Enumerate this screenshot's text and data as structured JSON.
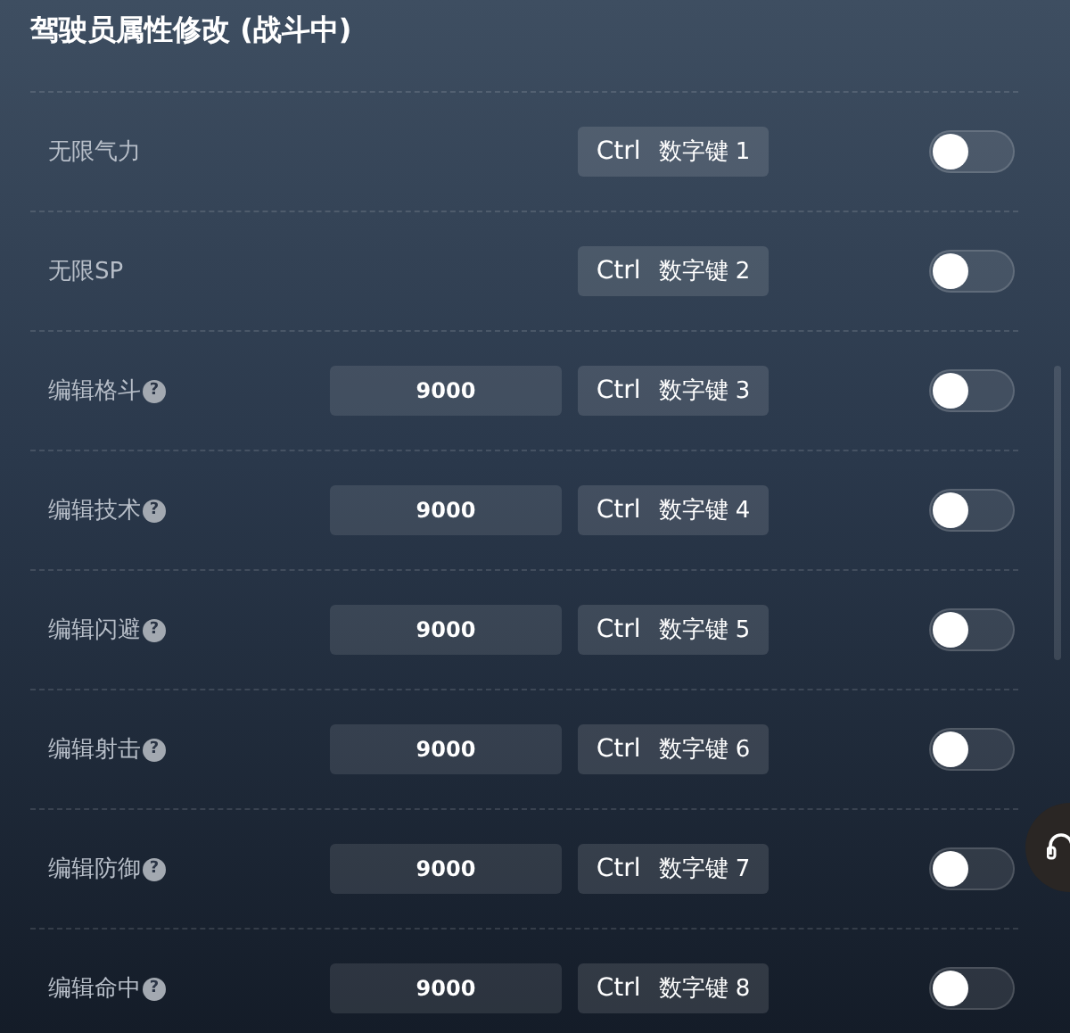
{
  "title": "驾驶员属性修改 (战斗中)",
  "rows": [
    {
      "kind": "toggle",
      "label": "无限气力",
      "hotkey_mod": "Ctrl",
      "hotkey_key": "数字键 1",
      "on": false
    },
    {
      "kind": "toggle",
      "label": "无限SP",
      "hotkey_mod": "Ctrl",
      "hotkey_key": "数字键 2",
      "on": false
    },
    {
      "kind": "value",
      "label": "编辑格斗",
      "help": "?",
      "value": "9000",
      "hotkey_mod": "Ctrl",
      "hotkey_key": "数字键 3",
      "on": false
    },
    {
      "kind": "value",
      "label": "编辑技术",
      "help": "?",
      "value": "9000",
      "hotkey_mod": "Ctrl",
      "hotkey_key": "数字键 4",
      "on": false
    },
    {
      "kind": "value",
      "label": "编辑闪避",
      "help": "?",
      "value": "9000",
      "hotkey_mod": "Ctrl",
      "hotkey_key": "数字键 5",
      "on": false
    },
    {
      "kind": "value",
      "label": "编辑射击",
      "help": "?",
      "value": "9000",
      "hotkey_mod": "Ctrl",
      "hotkey_key": "数字键 6",
      "on": false
    },
    {
      "kind": "value",
      "label": "编辑防御",
      "help": "?",
      "value": "9000",
      "hotkey_mod": "Ctrl",
      "hotkey_key": "数字键 7",
      "on": false
    },
    {
      "kind": "value",
      "label": "编辑命中",
      "help": "?",
      "value": "9000",
      "hotkey_mod": "Ctrl",
      "hotkey_key": "数字键 8",
      "on": false
    }
  ]
}
